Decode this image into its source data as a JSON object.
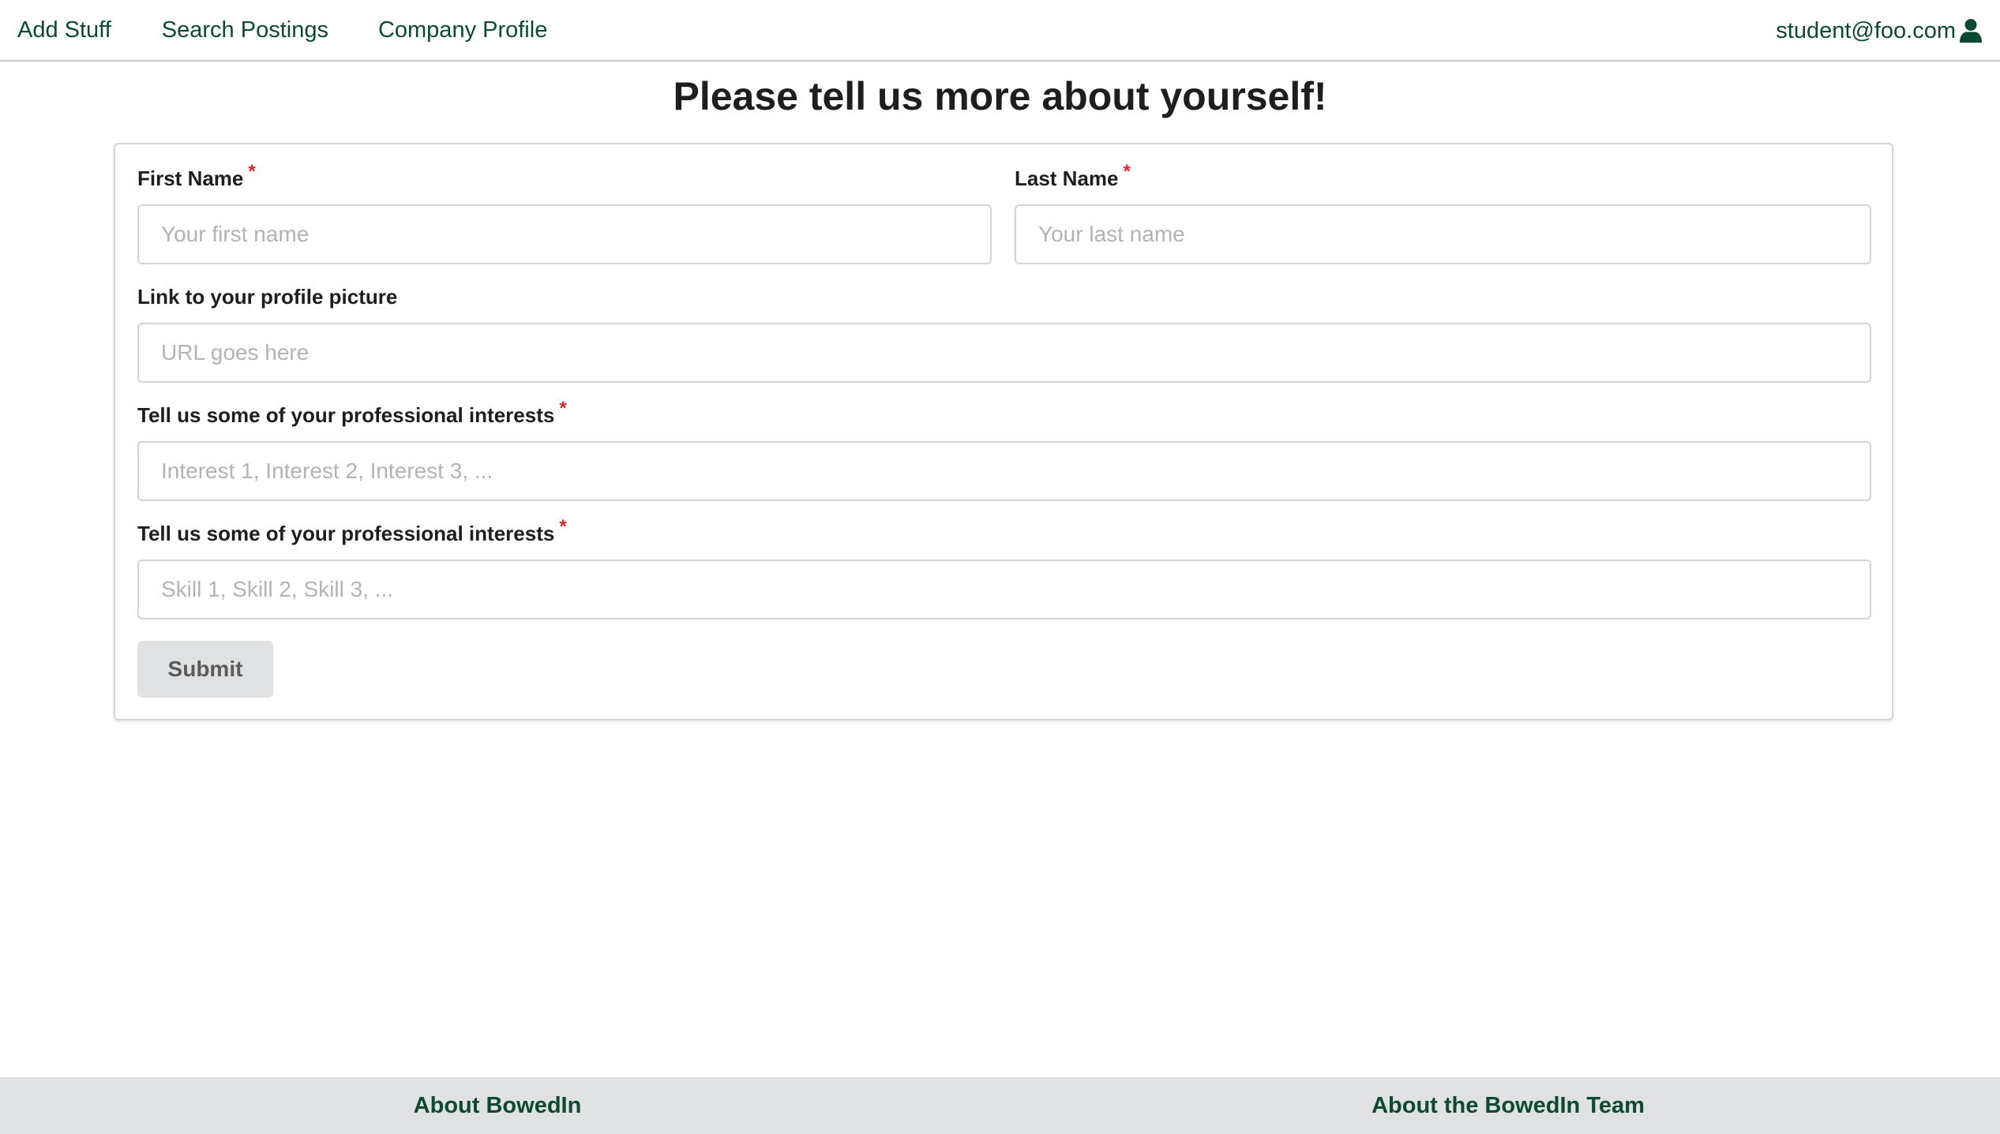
{
  "nav": {
    "links": [
      "Add Stuff",
      "Search Postings",
      "Company Profile"
    ],
    "user_email": "student@foo.com",
    "user_icon": "user-icon"
  },
  "page": {
    "title": "Please tell us more about yourself!"
  },
  "form": {
    "first_name": {
      "label": "First Name",
      "required_mark": "*",
      "placeholder": "Your first name",
      "value": ""
    },
    "last_name": {
      "label": "Last Name",
      "required_mark": "*",
      "placeholder": "Your last name",
      "value": ""
    },
    "picture": {
      "label": "Link to your profile picture",
      "placeholder": "URL goes here",
      "value": ""
    },
    "interests": {
      "label": "Tell us some of your professional interests",
      "required_mark": "*",
      "placeholder": "Interest 1, Interest 2, Interest 3, ...",
      "value": ""
    },
    "skills": {
      "label": "Tell us some of your professional interests",
      "required_mark": "*",
      "placeholder": "Skill 1, Skill 2, Skill 3, ...",
      "value": ""
    },
    "submit_label": "Submit"
  },
  "footer": {
    "about": "About BowedIn",
    "team": "About the BowedIn Team"
  },
  "colors": {
    "brand": "#0b4a2e",
    "required": "#db2828",
    "footer_bg": "#e0e1e2"
  }
}
